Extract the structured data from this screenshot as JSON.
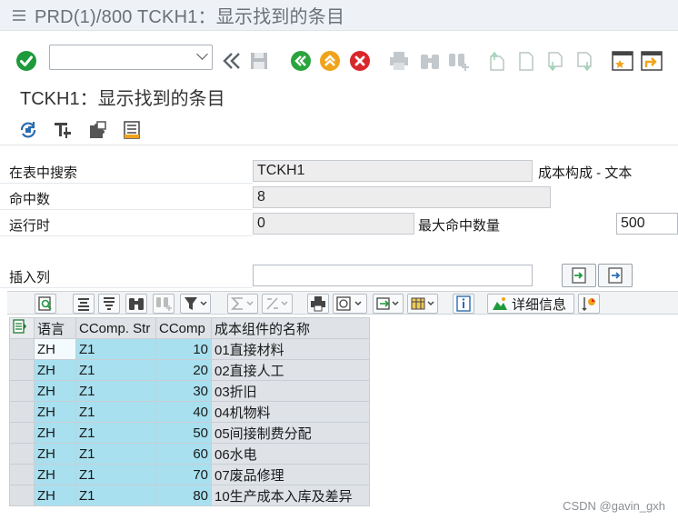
{
  "window": {
    "title": "PRD(1)/800 TCKH1：显示找到的条目"
  },
  "toolbar": {
    "command_value": ""
  },
  "screen": {
    "title": "TCKH1：显示找到的条目"
  },
  "form": {
    "search_in_table_label": "在表中搜索",
    "search_in_table_value": "TCKH1",
    "table_description": "成本构成 - 文本",
    "hits_label": "命中数",
    "hits_value": "8",
    "runtime_label": "运行时",
    "runtime_value": "0",
    "max_hits_label": "最大命中数量",
    "max_hits_value": "500",
    "insert_column_label": "插入列",
    "insert_column_value": ""
  },
  "alv": {
    "details_label": "详细信息"
  },
  "table": {
    "headers": [
      "语言",
      "CComp. Str",
      "CComp",
      "成本组件的名称"
    ],
    "rows": [
      [
        "ZH",
        "Z1",
        "10",
        "01直接材料"
      ],
      [
        "ZH",
        "Z1",
        "20",
        "02直接人工"
      ],
      [
        "ZH",
        "Z1",
        "30",
        "03折旧"
      ],
      [
        "ZH",
        "Z1",
        "40",
        "04机物料"
      ],
      [
        "ZH",
        "Z1",
        "50",
        "05间接制费分配"
      ],
      [
        "ZH",
        "Z1",
        "60",
        "06水电"
      ],
      [
        "ZH",
        "Z1",
        "70",
        "07废品修理"
      ],
      [
        "ZH",
        "Z1",
        "80",
        "10生产成本入库及差异"
      ]
    ]
  },
  "watermark": "CSDN @gavin_gxh",
  "colors": {
    "key_column": "#a8e0ef",
    "text_column": "#dfe3e8",
    "ok_green": "#1e9a3c",
    "nav_green": "#2aa43d",
    "nav_orange": "#f0a31a",
    "cancel_red": "#d9262b"
  }
}
